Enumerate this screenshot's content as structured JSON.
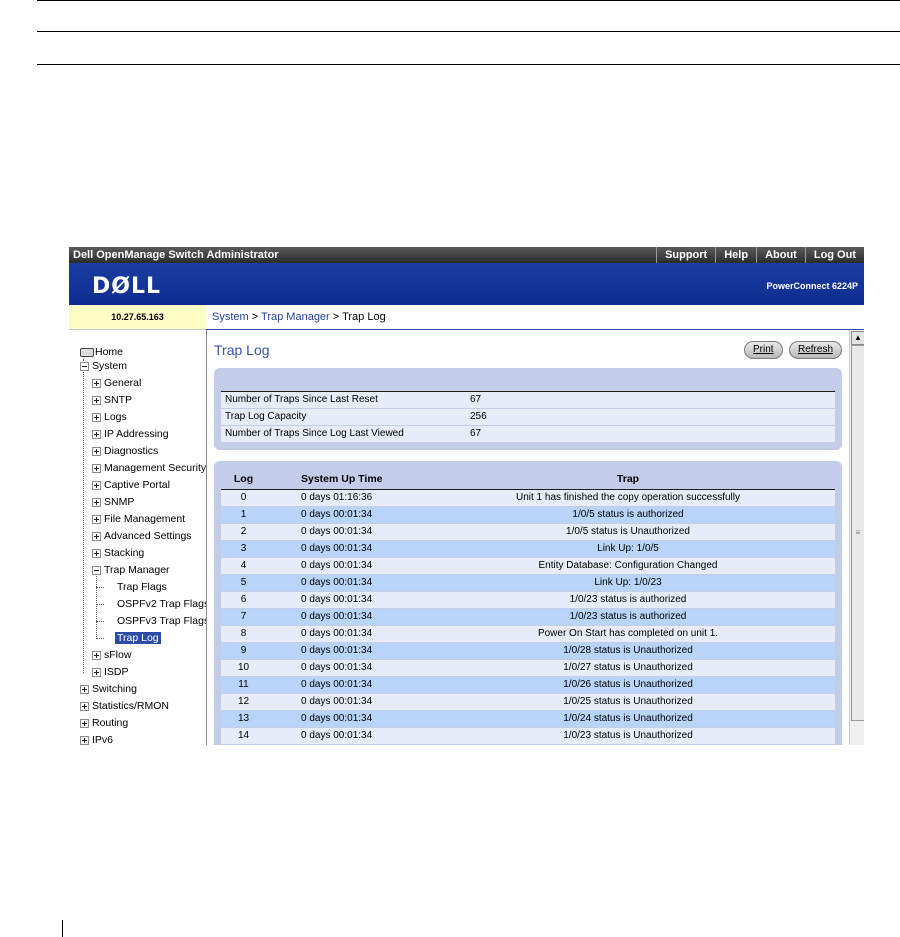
{
  "header": {
    "app_title": "Dell OpenManage Switch Administrator",
    "links": [
      "Support",
      "Help",
      "About",
      "Log Out"
    ]
  },
  "banner": {
    "logo": "DØLL",
    "model": "PowerConnect 6224P"
  },
  "ip": "10.27.65.163",
  "breadcrumb": {
    "system": "System",
    "trap_manager": "Trap Manager",
    "current": "Trap Log",
    "sep": " > "
  },
  "nav": {
    "home": "Home",
    "system": "System",
    "general": "General",
    "sntp": "SNTP",
    "logs": "Logs",
    "ip_addressing": "IP Addressing",
    "diagnostics": "Diagnostics",
    "management_security": "Management Security",
    "captive_portal": "Captive Portal",
    "snmp": "SNMP",
    "file_management": "File Management",
    "advanced_settings": "Advanced Settings",
    "stacking": "Stacking",
    "trap_manager": "Trap Manager",
    "trap_flags": "Trap Flags",
    "ospfv2": "OSPFv2 Trap Flags",
    "ospfv3": "OSPFv3 Trap Flags",
    "trap_log": "Trap Log",
    "sflow": "sFlow",
    "isdp": "ISDP",
    "switching": "Switching",
    "statistics": "Statistics/RMON",
    "routing": "Routing",
    "ipv6": "IPv6"
  },
  "page": {
    "title": "Trap Log",
    "print_label": "Print",
    "refresh_label": "Refresh"
  },
  "summary": {
    "rows": [
      {
        "label": "Number of Traps Since Last Reset",
        "value": "67"
      },
      {
        "label": "Trap Log Capacity",
        "value": "256"
      },
      {
        "label": "Number of Traps Since Log Last Viewed",
        "value": "67"
      }
    ]
  },
  "table": {
    "headers": {
      "log": "Log",
      "uptime": "System Up Time",
      "trap": "Trap"
    },
    "rows": [
      {
        "log": "0",
        "time": "0 days 01:16:36",
        "trap": "Unit 1 has finished the copy operation successfully"
      },
      {
        "log": "1",
        "time": "0 days 00:01:34",
        "trap": "1/0/5 status is authorized"
      },
      {
        "log": "2",
        "time": "0 days 00:01:34",
        "trap": "1/0/5 status is Unauthorized"
      },
      {
        "log": "3",
        "time": "0 days 00:01:34",
        "trap": "Link Up: 1/0/5"
      },
      {
        "log": "4",
        "time": "0 days 00:01:34",
        "trap": "Entity Database: Configuration Changed"
      },
      {
        "log": "5",
        "time": "0 days 00:01:34",
        "trap": "Link Up: 1/0/23"
      },
      {
        "log": "6",
        "time": "0 days 00:01:34",
        "trap": "1/0/23 status is authorized"
      },
      {
        "log": "7",
        "time": "0 days 00:01:34",
        "trap": "1/0/23 status is authorized"
      },
      {
        "log": "8",
        "time": "0 days 00:01:34",
        "trap": "Power On Start has completed on unit 1."
      },
      {
        "log": "9",
        "time": "0 days 00:01:34",
        "trap": "1/0/28 status is Unauthorized"
      },
      {
        "log": "10",
        "time": "0 days 00:01:34",
        "trap": "1/0/27 status is Unauthorized"
      },
      {
        "log": "11",
        "time": "0 days 00:01:34",
        "trap": "1/0/26 status is Unauthorized"
      },
      {
        "log": "12",
        "time": "0 days 00:01:34",
        "trap": "1/0/25 status is Unauthorized"
      },
      {
        "log": "13",
        "time": "0 days 00:01:34",
        "trap": "1/0/24 status is Unauthorized"
      },
      {
        "log": "14",
        "time": "0 days 00:01:34",
        "trap": "1/0/23 status is Unauthorized"
      }
    ]
  },
  "colors": {
    "accent": "#2b4ba6",
    "banner": "#1a3ea2",
    "panel": "#c3cdea",
    "row_light": "#e7ecf8",
    "row_alt": "#b8d4f8"
  }
}
